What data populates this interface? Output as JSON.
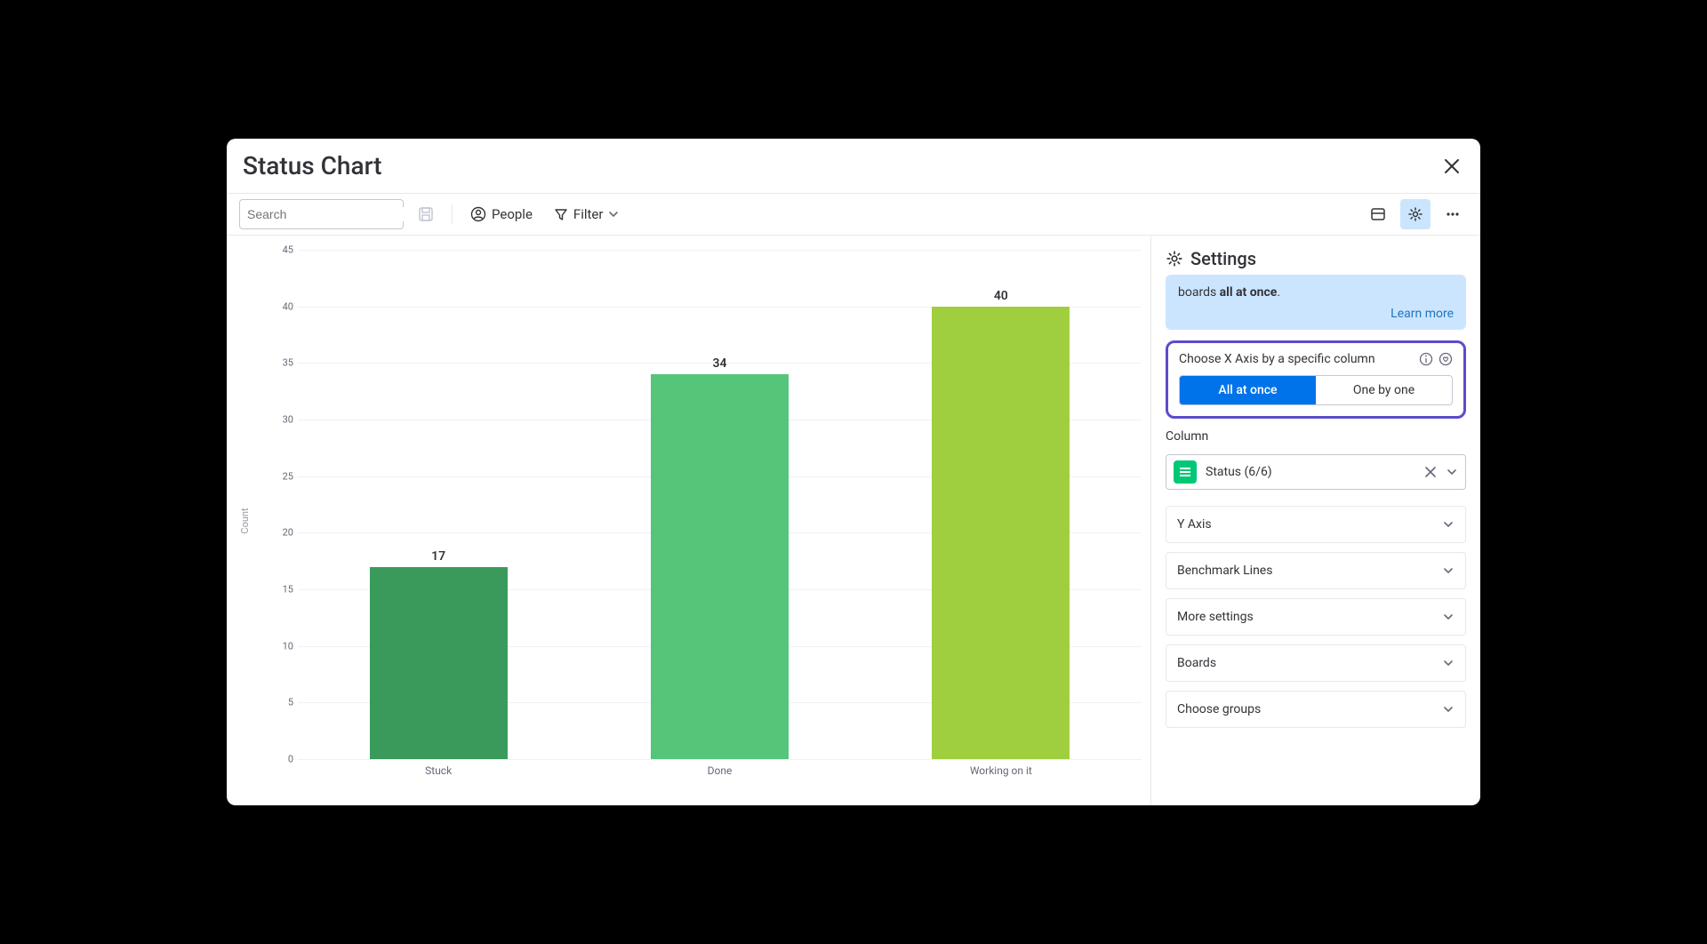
{
  "title": "Status Chart",
  "toolbar": {
    "search_placeholder": "Search",
    "people_label": "People",
    "filter_label": "Filter"
  },
  "chart_data": {
    "type": "bar",
    "ylabel": "Count",
    "ylim": [
      0,
      45
    ],
    "ticks": [
      0,
      5,
      10,
      15,
      20,
      25,
      30,
      35,
      40,
      45
    ],
    "categories": [
      "Stuck",
      "Done",
      "Working on it"
    ],
    "values": [
      17,
      34,
      40
    ],
    "colors": [
      "#3a9a5c",
      "#55c57a",
      "#9fcf3e"
    ]
  },
  "settings": {
    "header": "Settings",
    "info_text_tail": "boards ",
    "info_text_bold": "all at once",
    "info_dot": ".",
    "learn_more": "Learn more",
    "xaxis_label": "Choose X Axis by a specific column",
    "toggle_all": "All at once",
    "toggle_one": "One by one",
    "column_label": "Column",
    "column_value": "Status (6/6)",
    "accordions": [
      "Y Axis",
      "Benchmark Lines",
      "More settings",
      "Boards",
      "Choose groups"
    ]
  }
}
